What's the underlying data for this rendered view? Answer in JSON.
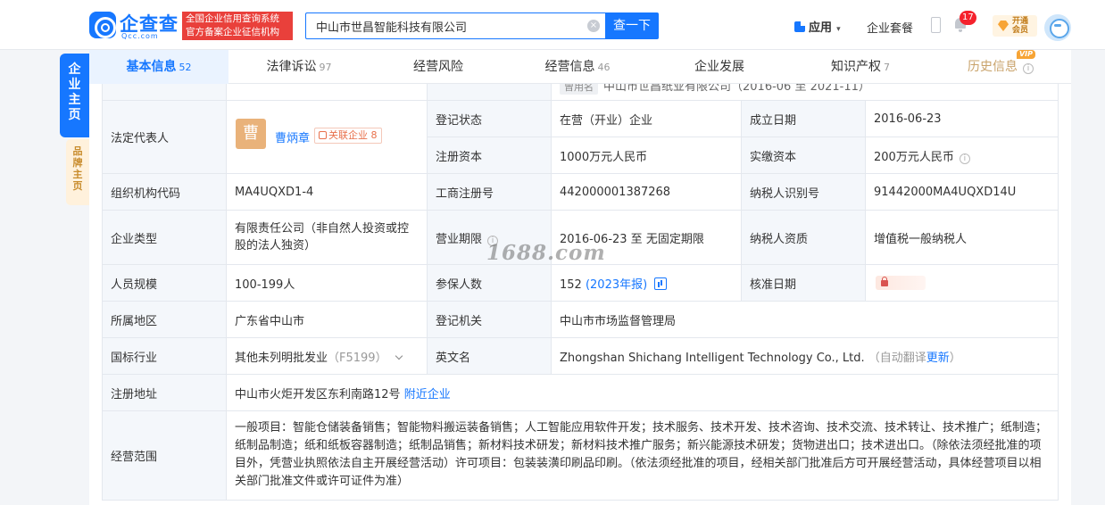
{
  "header": {
    "logo_cn": "企查查",
    "logo_en": "Qcc.com",
    "slogan_line1": "全国企业信用查询系统",
    "slogan_line2": "官方备案企业征信机构",
    "search_value": "中山市世昌智能科技有限公司",
    "search_button": "查一下",
    "apps_label": "应用",
    "package_label": "企业套餐",
    "notification_count": "17",
    "vip_line1": "开通",
    "vip_line2": "会员"
  },
  "side": {
    "main_tab": "企业主页",
    "brand_tab": "品牌主页"
  },
  "tabs": [
    {
      "label": "基本信息",
      "count": "52"
    },
    {
      "label": "法律诉讼",
      "count": "97"
    },
    {
      "label": "经营风险",
      "count": ""
    },
    {
      "label": "经营信息",
      "count": "46"
    },
    {
      "label": "企业发展",
      "count": ""
    },
    {
      "label": "知识产权",
      "count": "7"
    },
    {
      "label": "历史信息",
      "count": "",
      "vip": "VIP"
    }
  ],
  "info": {
    "former_name_tag": "曾用名",
    "former_name": "中山市世昌纸业有限公司（2016-06 至 2021-11）",
    "legal_rep_label": "法定代表人",
    "legal_rep_avatar": "曹",
    "legal_rep_name": "曹炳章",
    "legal_rep_related": "关联企业 8",
    "reg_status_label": "登记状态",
    "reg_status": "在营（开业）企业",
    "found_date_label": "成立日期",
    "found_date": "2016-06-23",
    "reg_capital_label": "注册资本",
    "reg_capital": "1000万元人民币",
    "paid_capital_label": "实缴资本",
    "paid_capital": "200万元人民币",
    "org_code_label": "组织机构代码",
    "org_code": "MA4UQXD1-4",
    "biz_reg_no_label": "工商注册号",
    "biz_reg_no": "442000001387268",
    "tax_id_label": "纳税人识别号",
    "tax_id": "91442000MA4UQXD14U",
    "company_type_label": "企业类型",
    "company_type": "有限责任公司（非自然人投资或控股的法人独资）",
    "biz_term_label": "营业期限",
    "biz_term": "2016-06-23 至 无固定期限",
    "taxpayer_qual_label": "纳税人资质",
    "taxpayer_qual": "增值税一般纳税人",
    "staff_size_label": "人员规模",
    "staff_size": "100-199人",
    "insured_label": "参保人数",
    "insured_count": "152",
    "insured_year": "(2023年报)",
    "approval_date_label": "核准日期",
    "region_label": "所属地区",
    "region": "广东省中山市",
    "reg_authority_label": "登记机关",
    "reg_authority": "中山市市场监督管理局",
    "industry_label": "国标行业",
    "industry": "其他未列明批发业",
    "industry_code": "（F5199）",
    "english_name_label": "英文名",
    "english_name": "Zhongshan Shichang Intelligent Technology Co., Ltd.",
    "auto_translate": "（自动翻译",
    "update_link": "更新",
    "auto_translate_end": "）",
    "address_label": "注册地址",
    "address": "中山市火炬开发区东利南路12号",
    "nearby_link": "附近企业",
    "scope_label": "经营范围",
    "scope": "一般项目：智能仓储装备销售；智能物料搬运装备销售；人工智能应用软件开发；技术服务、技术开发、技术咨询、技术交流、技术转让、技术推广；纸制造；纸制品制造；纸和纸板容器制造；纸制品销售；新材料技术研发；新材料技术推广服务；新兴能源技术研发；货物进出口；技术进出口。（除依法须经批准的项目外，凭营业执照依法自主开展经营活动）许可项目：包装装潢印刷品印刷。（依法须经批准的项目，经相关部门批准后方可开展经营活动，具体经营项目以相关部门批准文件或许可证件为准）"
  },
  "watermark": "1688.com"
}
